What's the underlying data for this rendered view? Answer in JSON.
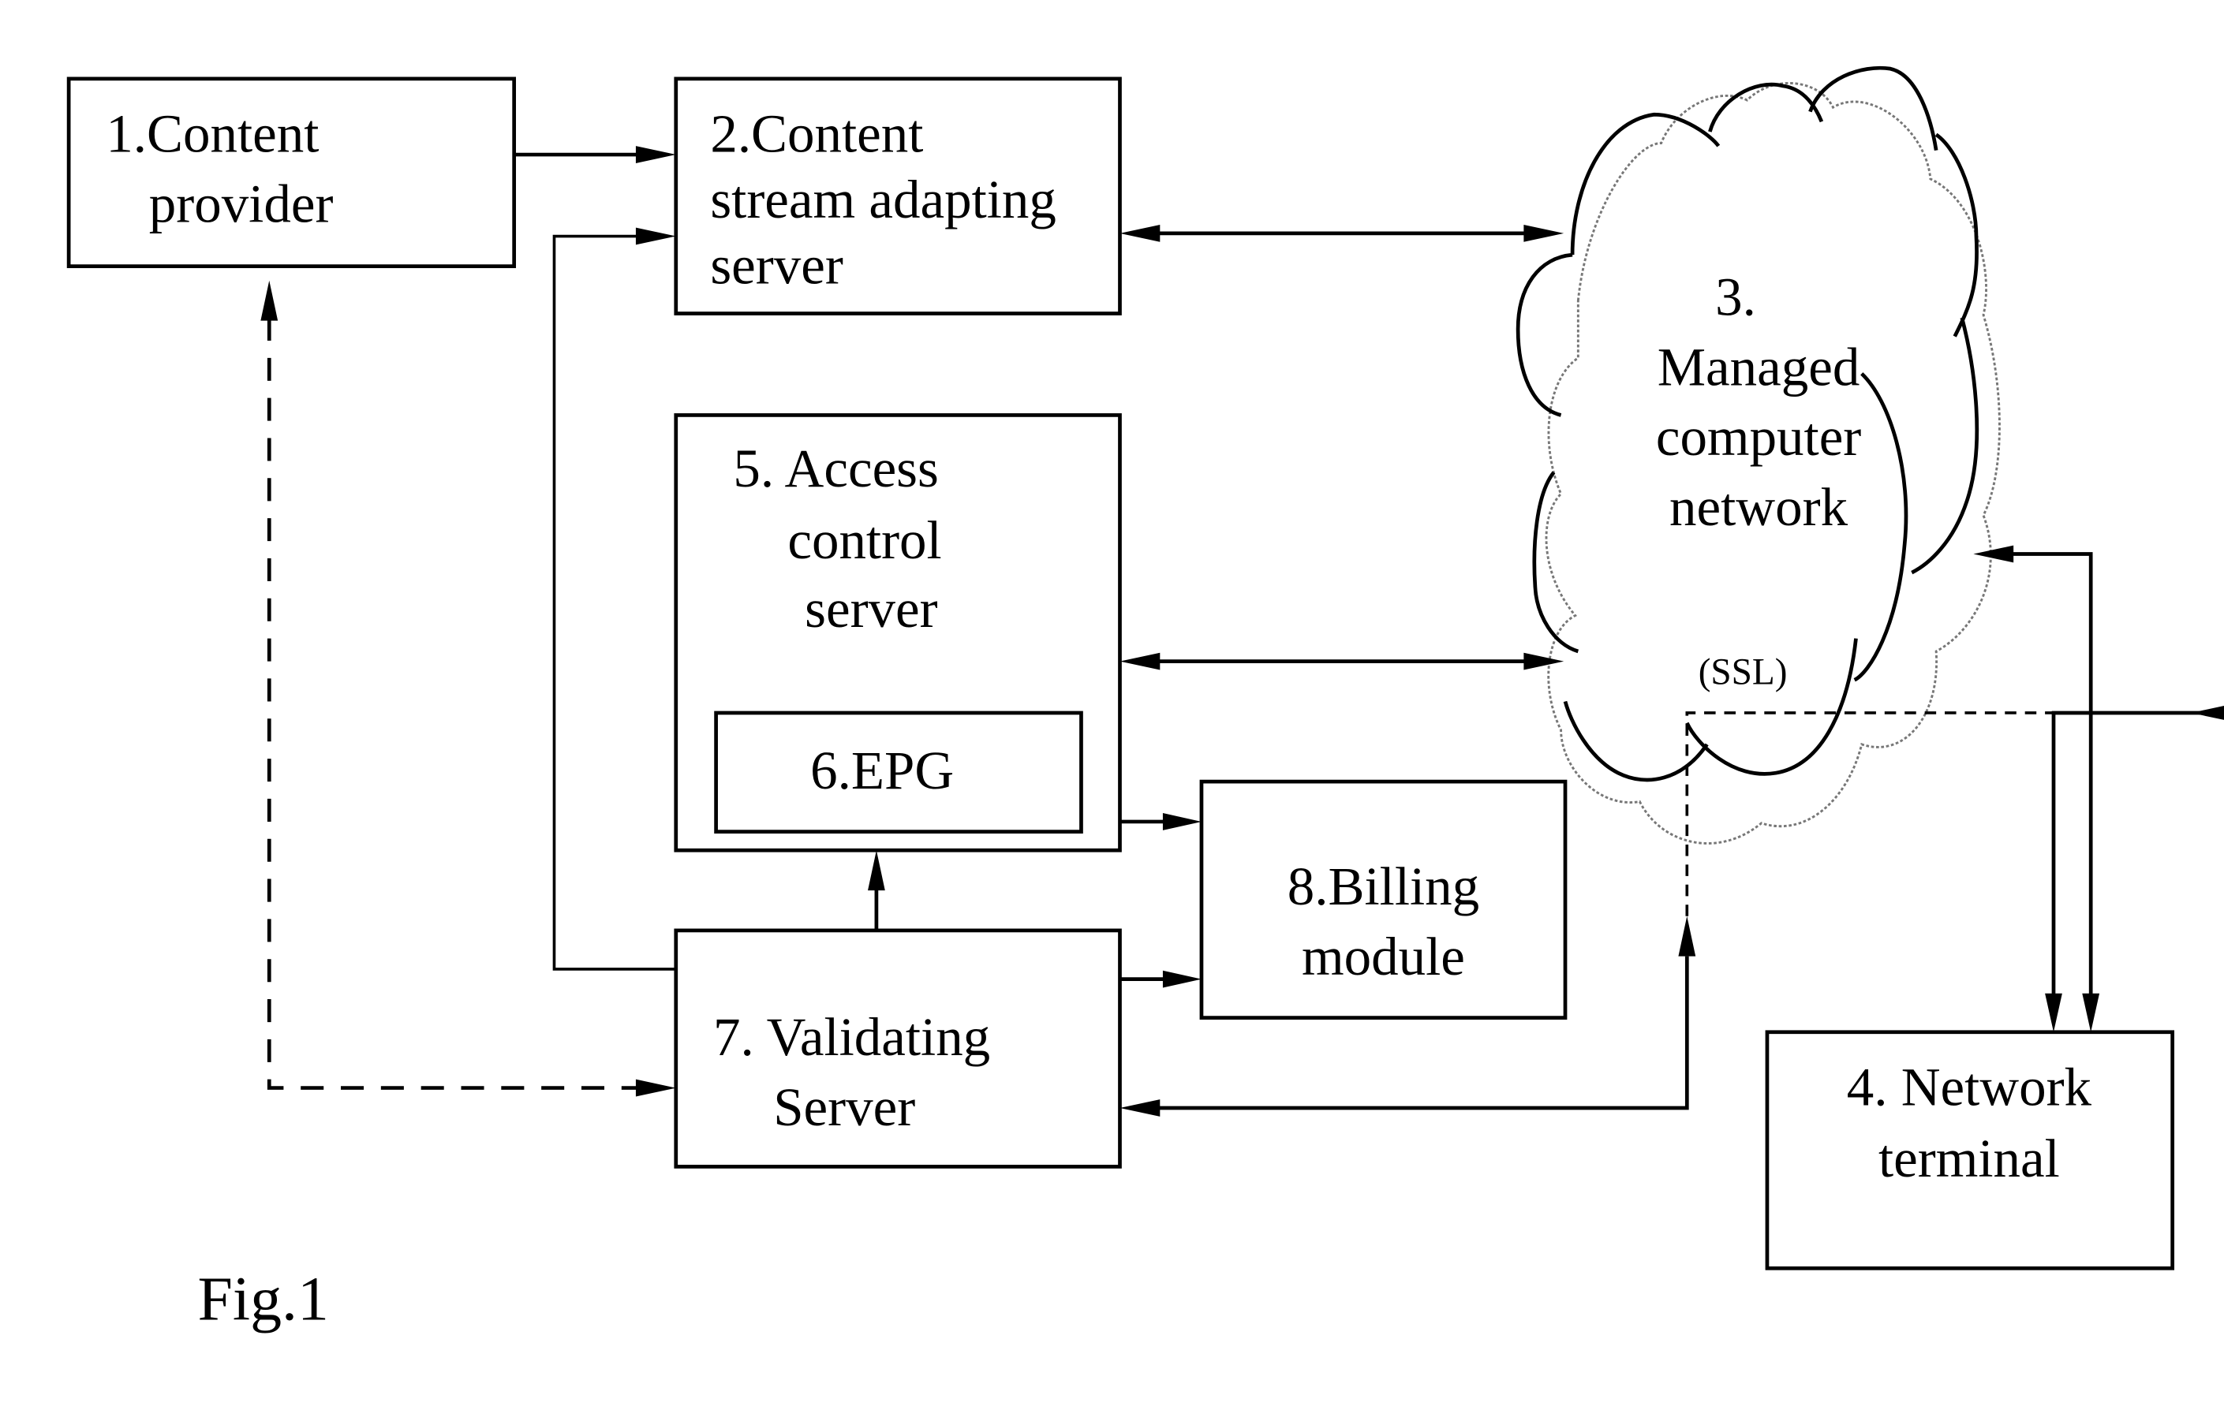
{
  "figure": {
    "caption": "Fig.1",
    "nodes": [
      {
        "id": "1",
        "lines": [
          "1.Content",
          "provider"
        ]
      },
      {
        "id": "2",
        "lines": [
          "2.Content",
          "stream adapting",
          "server"
        ]
      },
      {
        "id": "3",
        "lines": [
          "3.",
          "Managed",
          "computer",
          "network"
        ],
        "shape": "cloud"
      },
      {
        "id": "4",
        "lines": [
          "4. Network",
          "terminal"
        ]
      },
      {
        "id": "5",
        "lines": [
          "5. Access",
          "control",
          "server"
        ]
      },
      {
        "id": "6",
        "lines": [
          "6.EPG"
        ],
        "parent": "5"
      },
      {
        "id": "7",
        "lines": [
          "7. Validating",
          "Server"
        ]
      },
      {
        "id": "8",
        "lines": [
          "8.Billing",
          "module"
        ]
      }
    ],
    "ssl_label": "(SSL)",
    "edges": [
      {
        "from": "1",
        "to": "2",
        "style": "solid",
        "direction": "forward"
      },
      {
        "from": "7",
        "to": "2",
        "style": "solid",
        "direction": "forward"
      },
      {
        "from": "2",
        "to": "3",
        "style": "solid",
        "direction": "both"
      },
      {
        "from": "5",
        "to": "3",
        "style": "solid",
        "direction": "both"
      },
      {
        "from": "5",
        "to": "8",
        "style": "solid",
        "direction": "forward"
      },
      {
        "from": "7",
        "to": "5",
        "style": "solid",
        "direction": "forward"
      },
      {
        "from": "7",
        "to": "8",
        "style": "solid",
        "direction": "forward"
      },
      {
        "from": "1",
        "to": "7",
        "style": "dashed",
        "direction": "both"
      },
      {
        "from": "3",
        "to": "7",
        "style": "solid+dashed",
        "direction": "both",
        "label": "(SSL)"
      },
      {
        "from": "3",
        "to": "4",
        "style": "solid",
        "direction": "both"
      },
      {
        "from": "3",
        "to": "4",
        "style": "dashed+solid",
        "direction": "both",
        "label": "(SSL)"
      }
    ]
  }
}
